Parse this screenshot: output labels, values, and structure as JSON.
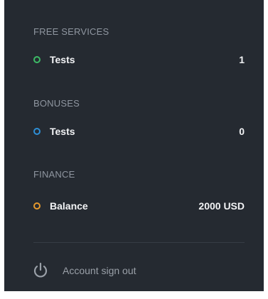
{
  "sections": [
    {
      "title": "FREE SERVICES",
      "row": {
        "label": "Tests",
        "value": "1",
        "dot_color": "#3dbb66"
      }
    },
    {
      "title": "BONUSES",
      "row": {
        "label": "Tests",
        "value": "0",
        "dot_color": "#2e8fd6"
      }
    },
    {
      "title": "FINANCE",
      "row": {
        "label": "Balance",
        "value": "2000 USD",
        "dot_color": "#e69a2e"
      }
    }
  ],
  "signout": {
    "label": "Account sign out",
    "icon": "power-icon"
  },
  "colors": {
    "panel_background": "#252a31",
    "section_title": "#8f96a0",
    "primary_text": "#f2f3f5",
    "muted_text": "#9aa0a8"
  }
}
